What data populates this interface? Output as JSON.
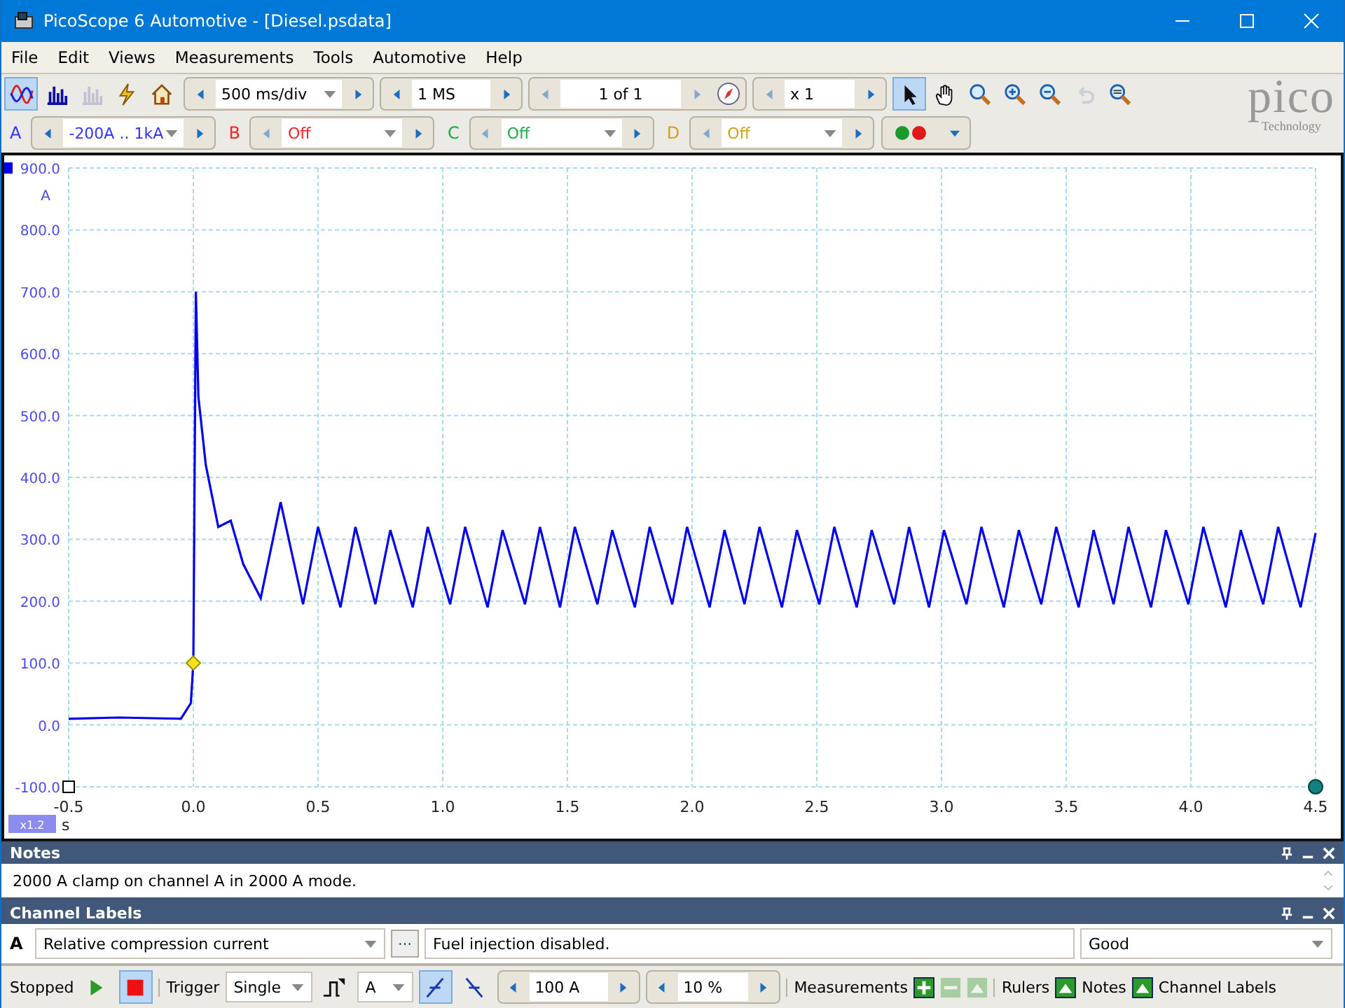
{
  "window": {
    "title": "PicoScope 6 Automotive - [Diesel.psdata]"
  },
  "menu": [
    "File",
    "Edit",
    "Views",
    "Measurements",
    "Tools",
    "Automotive",
    "Help"
  ],
  "toolbar": {
    "view_tools": [
      {
        "kind": "scope",
        "selected": true,
        "disabled": false
      },
      {
        "kind": "spectrum",
        "selected": false,
        "disabled": false
      },
      {
        "kind": "persistence",
        "selected": false,
        "disabled": true
      },
      {
        "kind": "auto-setup",
        "selected": false,
        "disabled": false
      },
      {
        "kind": "home",
        "selected": false,
        "disabled": false
      }
    ],
    "timebase": "500 ms/div",
    "samples": "1 MS",
    "buffer": "1 of 1",
    "zoom": "x 1",
    "pointer_tools": [
      {
        "kind": "pointer",
        "selected": true,
        "disabled": false
      },
      {
        "kind": "hand",
        "selected": false,
        "disabled": false
      },
      {
        "kind": "zoom-region",
        "selected": false,
        "disabled": false
      },
      {
        "kind": "zoom-in",
        "selected": false,
        "disabled": false
      },
      {
        "kind": "zoom-out",
        "selected": false,
        "disabled": false
      },
      {
        "kind": "undo",
        "selected": false,
        "disabled": true
      },
      {
        "kind": "zoom-full",
        "selected": false,
        "disabled": false
      }
    ]
  },
  "logo": {
    "name": "pico",
    "tagline": "Technology"
  },
  "channels": [
    {
      "letter": "A",
      "range": "-200A .. 1kA",
      "color": "#3333ff"
    },
    {
      "letter": "B",
      "range": "Off",
      "color": "#ff2222"
    },
    {
      "letter": "C",
      "range": "Off",
      "color": "#22aa44"
    },
    {
      "letter": "D",
      "range": "Off",
      "color": "#d4a017"
    }
  ],
  "scope": {
    "scale_badge": "x1.2",
    "chart_data": {
      "type": "line",
      "grid": true,
      "xlabel": "s",
      "ylabel": "A",
      "xlim": [
        -0.5,
        4.5
      ],
      "ylim": [
        -100,
        900
      ],
      "xticks": [
        {
          "value": -0.5,
          "label": "-0.5"
        },
        {
          "value": 0,
          "label": "0.0"
        },
        {
          "value": 0.5,
          "label": "0.5"
        },
        {
          "value": 1,
          "label": "1.0"
        },
        {
          "value": 1.5,
          "label": "1.5"
        },
        {
          "value": 2,
          "label": "2.0"
        },
        {
          "value": 2.5,
          "label": "2.5"
        },
        {
          "value": 3,
          "label": "3.0"
        },
        {
          "value": 3.5,
          "label": "3.5"
        },
        {
          "value": 4,
          "label": "4.0"
        },
        {
          "value": 4.5,
          "label": "4.5"
        }
      ],
      "yticks": [
        {
          "value": -100,
          "label": "-100.0"
        },
        {
          "value": 0,
          "label": "0.0"
        },
        {
          "value": 100,
          "label": "100.0"
        },
        {
          "value": 200,
          "label": "200.0"
        },
        {
          "value": 300,
          "label": "300.0"
        },
        {
          "value": 400,
          "label": "400.0"
        },
        {
          "value": 500,
          "label": "500.0"
        },
        {
          "value": 600,
          "label": "600.0"
        },
        {
          "value": 700,
          "label": "700.0"
        },
        {
          "value": 800,
          "label": "800.0"
        },
        {
          "value": 900,
          "label": "900.0"
        }
      ],
      "x": [
        -0.5,
        -0.3,
        -0.05,
        -0.01,
        0,
        0.01,
        0.02,
        0.05,
        0.1,
        0.15,
        0.2,
        0.27,
        0.35,
        0.44,
        0.5,
        0.59,
        0.65,
        0.73,
        0.79,
        0.88,
        0.94,
        1.03,
        1.09,
        1.18,
        1.24,
        1.33,
        1.39,
        1.47,
        1.53,
        1.62,
        1.68,
        1.77,
        1.83,
        1.92,
        1.98,
        2.07,
        2.13,
        2.21,
        2.27,
        2.36,
        2.42,
        2.51,
        2.57,
        2.66,
        2.72,
        2.81,
        2.87,
        2.95,
        3.01,
        3.1,
        3.16,
        3.25,
        3.31,
        3.4,
        3.46,
        3.55,
        3.61,
        3.69,
        3.75,
        3.84,
        3.9,
        3.99,
        4.05,
        4.14,
        4.2,
        4.29,
        4.35,
        4.44,
        4.5
      ],
      "series": [
        {
          "color": "#0000ee",
          "values": [
            10,
            12,
            10,
            35,
            100,
            700,
            530,
            420,
            320,
            330,
            260,
            205,
            360,
            195,
            320,
            190,
            320,
            195,
            315,
            190,
            320,
            195,
            320,
            190,
            315,
            195,
            320,
            190,
            320,
            195,
            315,
            190,
            320,
            195,
            320,
            190,
            315,
            195,
            320,
            190,
            315,
            195,
            320,
            190,
            315,
            195,
            320,
            190,
            315,
            195,
            320,
            190,
            315,
            195,
            320,
            190,
            315,
            195,
            320,
            190,
            315,
            195,
            320,
            190,
            315,
            195,
            320,
            190,
            310
          ]
        }
      ]
    }
  },
  "notes": {
    "title": "Notes",
    "text": "2000 A clamp on channel A in 2000 A mode."
  },
  "channel_labels": {
    "title": "Channel Labels",
    "channel": "A",
    "label": "Relative compression current",
    "more": "···",
    "description": "Fuel injection disabled.",
    "rating": "Good"
  },
  "status_bar": {
    "status": "Stopped",
    "running": false,
    "trigger_label": "Trigger",
    "trigger_mode": "Single",
    "trigger_channel": "A",
    "rising_edge": true,
    "threshold": "100 A",
    "pretrigger": "10 %",
    "measurements_label": "Measurements",
    "rulers_label": "Rulers",
    "notes_label": "Notes",
    "channel_labels_label": "Channel Labels"
  }
}
